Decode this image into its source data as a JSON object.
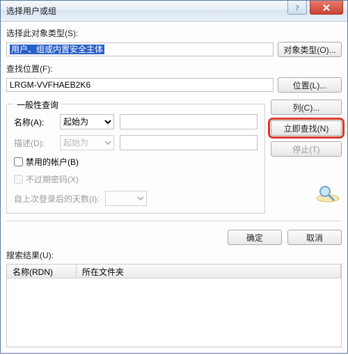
{
  "title": "选择用户或组",
  "labels": {
    "object_type": "选择此对象类型(S):",
    "object_type_value": "用户、组或内置安全主体",
    "location": "查找位置(F):",
    "location_value": "LRGM-VVFHAEB2K6",
    "groupbox": "一般性查询",
    "name": "名称(A):",
    "desc": "描述(D):",
    "combo_starts": "起始为",
    "cb_disabled_accounts": "禁用的帐户(B)",
    "cb_nonexpiring": "不过期密码(X)",
    "days_since_logon": "自上次登录后的天数(I):",
    "search_results": "搜索结果(U):",
    "col_name": "名称(RDN)",
    "col_folder": "所在文件夹"
  },
  "buttons": {
    "object_types": "对象类型(O)...",
    "locations": "位置(L)...",
    "columns": "列(C)...",
    "find_now": "立即查找(N)",
    "stop": "停止(T)",
    "ok": "确定",
    "cancel": "取消"
  }
}
